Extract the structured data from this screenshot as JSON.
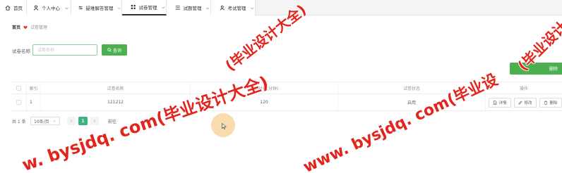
{
  "nav": {
    "tabs": [
      {
        "label": "首页",
        "icon": "home-icon"
      },
      {
        "label": "个人中心",
        "icon": "user-icon"
      },
      {
        "label": "疑难解答管理",
        "icon": "sliders-icon"
      },
      {
        "label": "试卷管理",
        "icon": "grid-icon",
        "active": true
      },
      {
        "label": "试题管理",
        "icon": "list-icon"
      },
      {
        "label": "考试管理",
        "icon": "user-icon"
      }
    ]
  },
  "breadcrumb": {
    "home": "首页",
    "separator_icon": "heart-icon",
    "current": "试卷管理"
  },
  "search": {
    "label": "试卷名称",
    "input_value": "",
    "placeholder": "试卷名称",
    "button_label": "查询",
    "button_icon": "search-icon"
  },
  "toolbar": {
    "delete_label": "删除"
  },
  "table": {
    "headers": [
      "索引",
      "试卷名称",
      "考试时长(分钟)",
      "试卷状态",
      "操作"
    ],
    "rows": [
      {
        "index": "1",
        "name": "121212",
        "duration": "120",
        "status": "启用"
      }
    ],
    "row_actions": {
      "detail": "详情",
      "edit": "修改",
      "delete": "删除"
    }
  },
  "pagination": {
    "total": "共 1 条",
    "page_size": "10条/页",
    "current_page": "1",
    "goto": "前往"
  },
  "watermarks": [
    "(毕业设计大全)",
    "w. bysjdq. com(毕业设计大全)",
    "www. bysjdq. com(毕业设",
    "(毕业设计"
  ],
  "colors": {
    "accent": "#4caf50",
    "page_active": "#3fb37f",
    "watermark": "#e3241c",
    "breadcrumb_heart": "#e53935"
  }
}
